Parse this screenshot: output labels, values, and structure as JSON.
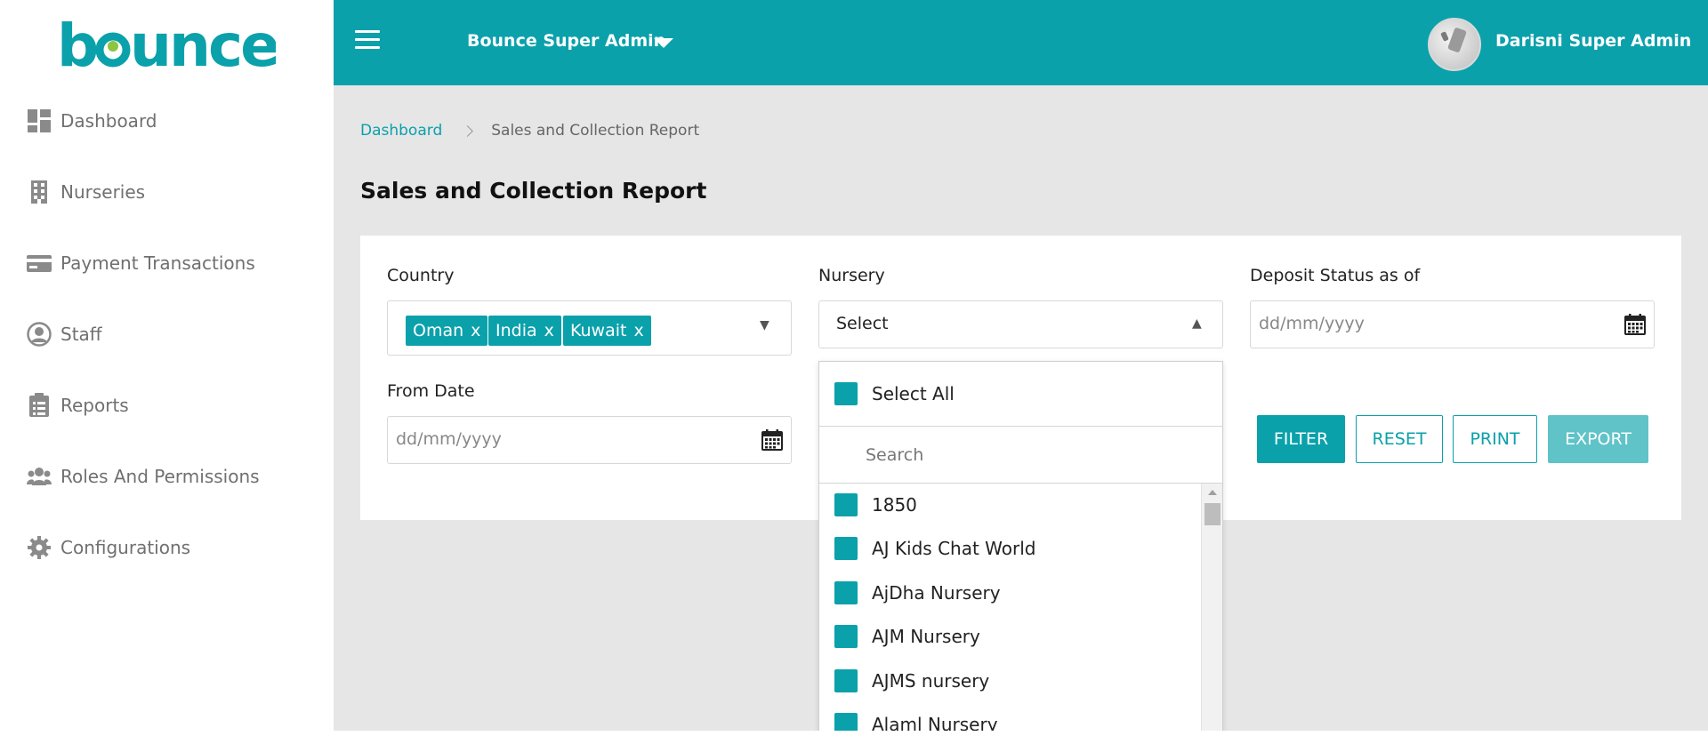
{
  "app": {
    "logo_text": "bounce",
    "brand_color": "#0aa1ab"
  },
  "sidebar": {
    "items": [
      {
        "label": "Dashboard",
        "icon": "dashboard-icon"
      },
      {
        "label": "Nurseries",
        "icon": "building-icon"
      },
      {
        "label": "Payment Transactions",
        "icon": "credit-card-icon"
      },
      {
        "label": "Staff",
        "icon": "user-circle-icon"
      },
      {
        "label": "Reports",
        "icon": "clipboard-icon"
      },
      {
        "label": "Roles And Permissions",
        "icon": "users-icon"
      },
      {
        "label": "Configurations",
        "icon": "gear-icon"
      }
    ]
  },
  "header": {
    "org_name": "Bounce Super Admin",
    "user_name": "Darisni Super Admin"
  },
  "breadcrumb": {
    "home": "Dashboard",
    "current": "Sales and Collection Report"
  },
  "page": {
    "title": "Sales and Collection Report"
  },
  "filters": {
    "country": {
      "label": "Country",
      "selected": [
        "Oman",
        "India",
        "Kuwait"
      ],
      "remove_glyph": "x"
    },
    "nursery": {
      "label": "Nursery",
      "value": "Select",
      "dropdown": {
        "select_all": "Select All",
        "search_placeholder": "Search",
        "options": [
          "1850",
          "AJ Kids Chat World",
          "AjDha Nursery",
          "AJM Nursery",
          "AJMS nursery",
          "Alaml Nursery"
        ]
      }
    },
    "deposit_status": {
      "label": "Deposit Status as of",
      "placeholder": "dd/mm/yyyy"
    },
    "from_date": {
      "label": "From Date",
      "placeholder": "dd/mm/yyyy"
    }
  },
  "actions": {
    "filter": "FILTER",
    "reset": "RESET",
    "print": "PRINT",
    "export": "EXPORT"
  }
}
